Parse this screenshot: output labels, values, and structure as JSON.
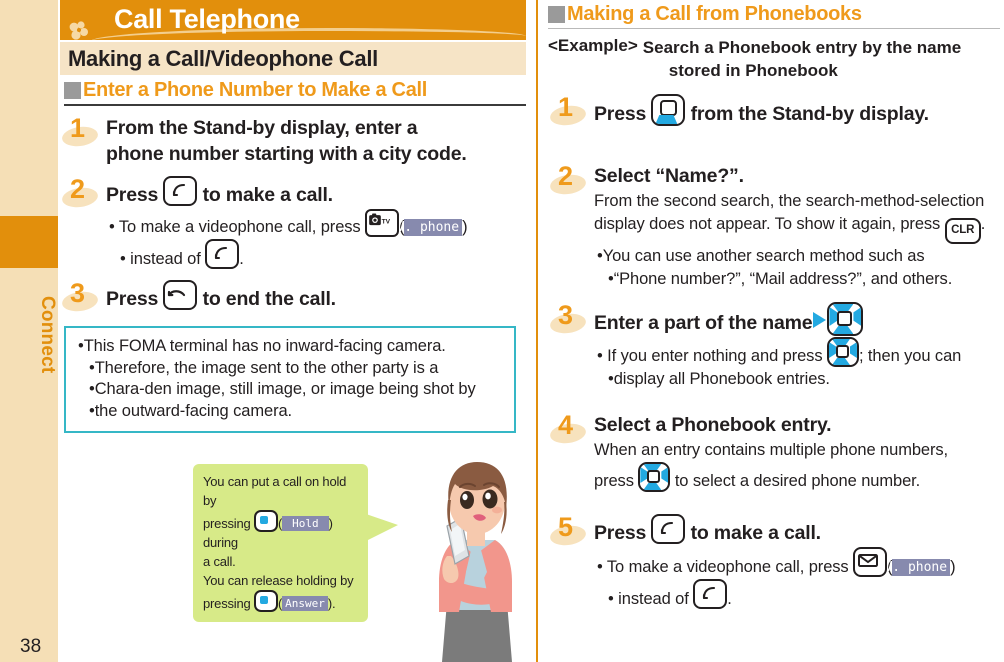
{
  "sidebar": {
    "tab_label": "Connect",
    "page_number": "38",
    "tab_color": "#e28f0c",
    "bg_color": "#f5dfb6"
  },
  "left_column": {
    "chapter_title": "Call Telephone",
    "section_title": "Making a Call/Videophone Call",
    "subsection_title": "Enter a Phone Number to Make a Call",
    "steps": [
      {
        "number": "1",
        "title_line1": "From the Stand-by display, enter a",
        "title_line2": "phone number starting with a city code."
      },
      {
        "number": "2",
        "title_pre": "Press",
        "title_post": "to make a call.",
        "bullet_pre": "To make a videophone call, press",
        "bullet_badge": "V. phone",
        "bullet_post": "instead of",
        "bullet_end": "."
      },
      {
        "number": "3",
        "title_pre": "Press",
        "title_post": "to end the call."
      }
    ],
    "note": {
      "line1": "This FOMA terminal has no inward-facing camera.",
      "line2": "Therefore, the image sent to the other party is a",
      "line3": "Chara-den image, still image, or image being shot by",
      "line4": "the outward-facing camera.",
      "border_color": "#35b7c6"
    },
    "balloon": {
      "line1_pre": "You can put a call on hold by",
      "line2_pre": "pressing",
      "line2_badge": "Hold",
      "line2_post": ") during",
      "line3": "a call.",
      "line4": "You can release holding by",
      "line5_pre": "pressing",
      "line5_badge": "Answer",
      "line5_post": ").",
      "bg_color": "#d7ea88"
    }
  },
  "right_column": {
    "subsection_title": "Making a Call from Phonebooks",
    "example_tag": "<Example>",
    "example_line1": "Search a Phonebook entry by the name",
    "example_line2": "stored in Phonebook",
    "steps": [
      {
        "number": "1",
        "title_pre": "Press",
        "title_post": "from the Stand-by display."
      },
      {
        "number": "2",
        "title": "Select “Name?”.",
        "body_line1": "From the second search, the search-method-selection",
        "body_line2_pre": "display does not appear. To show it again, press",
        "body_line2_post": ".",
        "bullet_line1": "You can use another search method such as",
        "bullet_line2": "“Phone number?”, “Mail address?”, and others."
      },
      {
        "number": "3",
        "title_pre": "Enter a part of the name",
        "bullet_pre": "If you enter nothing and press",
        "bullet_mid": "; then you can",
        "bullet_line2": "display all Phonebook entries."
      },
      {
        "number": "4",
        "title": "Select a Phonebook entry.",
        "body_line1": "When an entry contains multiple phone numbers,",
        "body_line2_pre": "press",
        "body_line2_post": "to select a desired phone number."
      },
      {
        "number": "5",
        "title_pre": "Press",
        "title_post": "to make a call.",
        "bullet_pre": "To make a videophone call, press",
        "bullet_badge": "V. phone",
        "bullet_post": "instead of",
        "bullet_end": "."
      }
    ]
  },
  "icons": {
    "send_key": "send-call-key-icon",
    "end_key": "end-call-key-icon",
    "camera_tv_key": "camera-tv-key-icon",
    "mail_key": "mail-key-icon",
    "clr_key": "CLR",
    "center_key": "center-select-key-icon",
    "down_key": "down-navigation-key-icon",
    "fourway_key": "four-way-navigation-key-icon"
  },
  "colors": {
    "accent_orange": "#e28f0c",
    "heading_orange": "#ef9a1b",
    "badge_purple": "#878aae",
    "key_blue": "#23a9e1",
    "note_cyan": "#35b7c6",
    "balloon_green": "#d7ea88"
  }
}
